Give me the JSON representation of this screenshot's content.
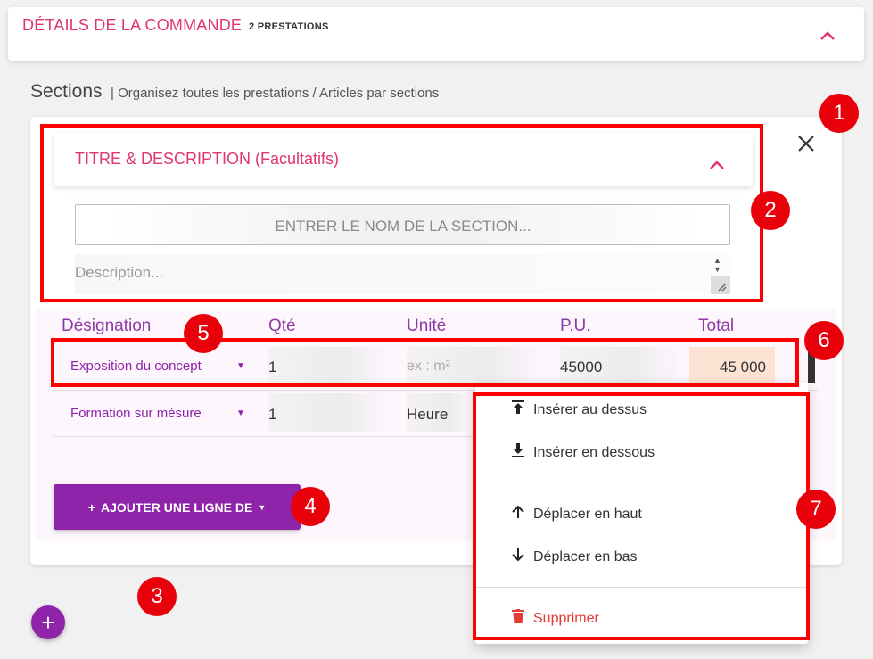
{
  "order_header": {
    "title": "DÉTAILS DE LA COMMANDE",
    "count": "2 PRESTATIONS"
  },
  "sections": {
    "title": "Sections",
    "subtitle": "| Organisez toutes les prestations / Articles par sections"
  },
  "section_card": {
    "panel_title": "TITRE & DESCRIPTION (Facultatifs)",
    "name_placeholder": "ENTRER LE NOM DE LA SECTION...",
    "description_placeholder": "Description...",
    "columns": [
      "Désignation",
      "Qté",
      "Unité",
      "P.U.",
      "Total"
    ],
    "rows": [
      {
        "designation": "Exposition du concept",
        "qty": "1",
        "unit_placeholder": "ex : m²",
        "unit": "",
        "pu": "45000",
        "total": "45 000"
      },
      {
        "designation": "Formation sur mésure",
        "qty": "1",
        "unit": "Heure"
      }
    ],
    "add_line_label": "AJOUTER UNE LIGNE DE"
  },
  "context_menu": {
    "items": [
      {
        "label": "Insérer au dessus",
        "icon": "insert-above-icon"
      },
      {
        "label": "Insérer en dessous",
        "icon": "insert-below-icon"
      },
      {
        "label": "Déplacer en haut",
        "icon": "arrow-up-icon"
      },
      {
        "label": "Déplacer en bas",
        "icon": "arrow-down-icon"
      },
      {
        "label": "Supprimer",
        "icon": "trash-icon"
      }
    ]
  },
  "annotations": [
    "1",
    "2",
    "3",
    "4",
    "5",
    "6",
    "7"
  ],
  "colors": {
    "accent_pink": "#e0356f",
    "accent_purple": "#8e24aa",
    "annotation_red": "#e8000b",
    "delete_red": "#e53935"
  }
}
